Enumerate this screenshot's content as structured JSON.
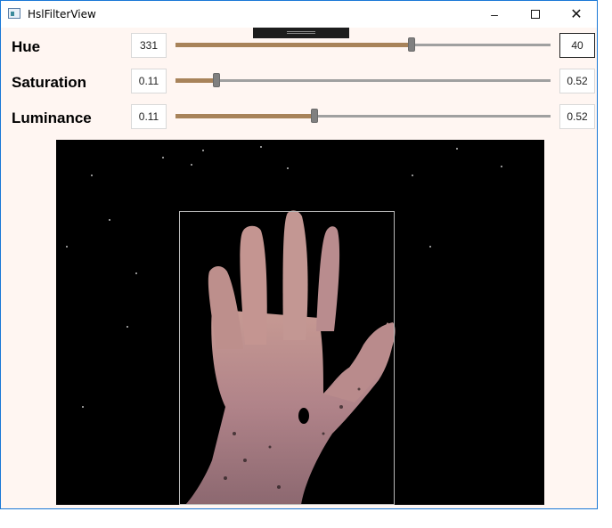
{
  "window": {
    "title": "HslFilterView",
    "minimize_icon": "minimize-icon",
    "maximize_icon": "maximize-icon",
    "close_icon": "close-icon"
  },
  "controls": [
    {
      "label": "Hue",
      "min_value": "331",
      "max_value": "40",
      "slider_fraction": 0.63
    },
    {
      "label": "Saturation",
      "min_value": "0.11",
      "max_value": "0.52",
      "slider_fraction": 0.11
    },
    {
      "label": "Luminance",
      "min_value": "0.11",
      "max_value": "0.52",
      "slider_fraction": 0.37
    }
  ],
  "colors": {
    "slider_fill": "#a8835a",
    "background": "#fff6f2",
    "image_background": "#000000"
  }
}
